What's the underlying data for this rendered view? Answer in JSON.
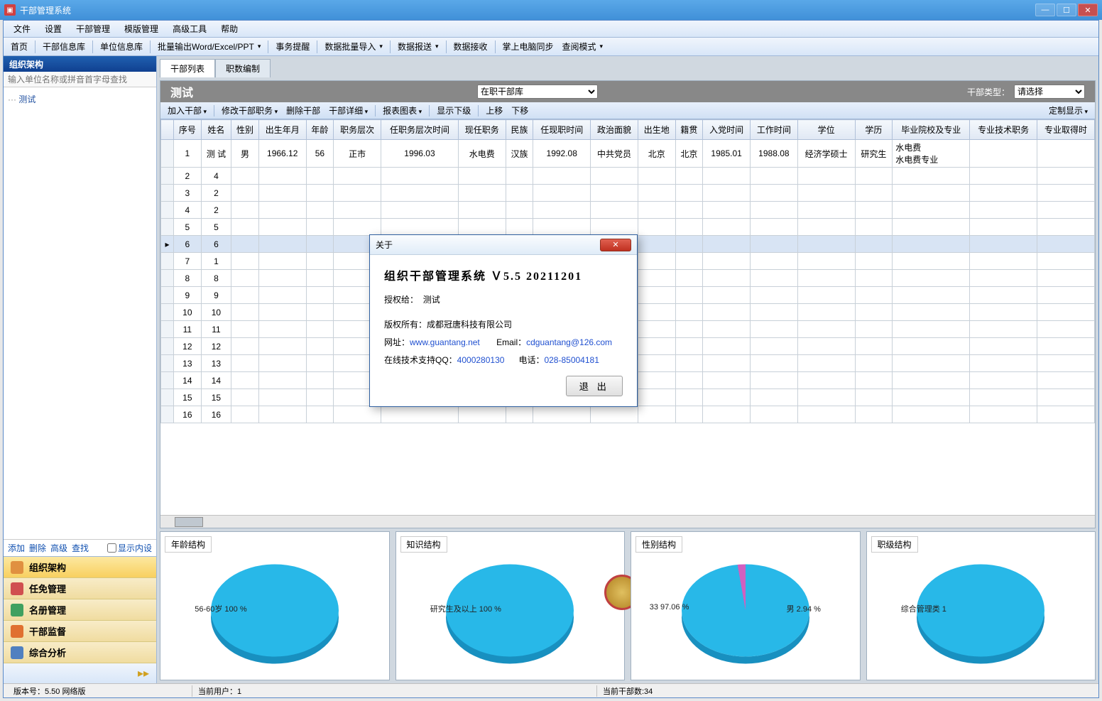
{
  "window": {
    "title": "干部管理系统"
  },
  "menu": [
    "文件",
    "设置",
    "干部管理",
    "模版管理",
    "高级工具",
    "帮助"
  ],
  "toolbar": [
    "首页",
    "干部信息库",
    "单位信息库",
    "批量输出Word/Excel/PPT",
    "事务提醒",
    "数据批量导入",
    "数据报送",
    "数据接收",
    "掌上电脑同步",
    "查阅模式"
  ],
  "toolbar_dd": [
    3,
    5,
    6,
    9
  ],
  "sidebar": {
    "header": "组织架构",
    "search_placeholder": "输入单位名称或拼音首字母查找",
    "tree_root": "测试",
    "actions": [
      "添加",
      "删除",
      "高级",
      "查找"
    ],
    "show_internal": "显示内设",
    "nav": [
      "组织架构",
      "任免管理",
      "名册管理",
      "干部监督",
      "综合分析"
    ]
  },
  "tabs": [
    "干部列表",
    "职数编制"
  ],
  "tabs_active": 0,
  "panel": {
    "title": "测试",
    "db_options": [
      "在职干部库"
    ],
    "type_label": "干部类型：",
    "type_options": [
      "请选择"
    ],
    "toolbar": [
      "加入干部",
      "修改干部职务",
      "删除干部",
      "干部详细",
      "报表图表",
      "显示下级",
      "上移",
      "下移"
    ],
    "toolbar_dd": [
      0,
      1,
      3,
      4
    ],
    "custom": "定制显示"
  },
  "columns": [
    "序号",
    "姓名",
    "性别",
    "出生年月",
    "年龄",
    "职务层次",
    "任职务层次时间",
    "现任职务",
    "民族",
    "任现职时间",
    "政治面貌",
    "出生地",
    "籍贯",
    "入党时间",
    "工作时间",
    "学位",
    "学历",
    "毕业院校及专业",
    "专业技术职务",
    "专业取得时"
  ],
  "rows": [
    {
      "n": 1,
      "c2": "测　试",
      "name": "测 试",
      "sex": "男",
      "dob": "1966.12",
      "age": "56",
      "lvl": "正市",
      "lvlt": "1996.03",
      "job": "水电费",
      "eth": "汉族",
      "jobt": "1992.08",
      "pol": "中共党员",
      "birth": "北京",
      "orig": "北京",
      "party": "1985.01",
      "work": "1988.08",
      "deg": "经济学硕士",
      "edu": "研究生",
      "school": "水电费\n水电费专业"
    },
    {
      "n": 2,
      "c2": "4"
    },
    {
      "n": 3,
      "c2": "2"
    },
    {
      "n": 4,
      "c2": "2"
    },
    {
      "n": 5,
      "c2": "5"
    },
    {
      "n": 6,
      "c2": "6",
      "sel": true
    },
    {
      "n": 7,
      "c2": "1"
    },
    {
      "n": 8,
      "c2": "8"
    },
    {
      "n": 9,
      "c2": "9"
    },
    {
      "n": 10,
      "c2": "10"
    },
    {
      "n": 11,
      "c2": "11"
    },
    {
      "n": 12,
      "c2": "12"
    },
    {
      "n": 13,
      "c2": "13"
    },
    {
      "n": 14,
      "c2": "14"
    },
    {
      "n": 15,
      "c2": "15"
    },
    {
      "n": 16,
      "c2": "16"
    }
  ],
  "charts": [
    {
      "title": "年龄结构",
      "label": "56-60岁 100 %"
    },
    {
      "title": "知识结构",
      "label": "研究生及以上 100 %"
    },
    {
      "title": "性别结构",
      "label": "33 97.06 %",
      "label2": "男 2.94 %",
      "sliced": true
    },
    {
      "title": "职级结构",
      "label": "综合管理类 1"
    }
  ],
  "chart_data": [
    {
      "type": "pie",
      "title": "年龄结构",
      "series": [
        {
          "name": "56-60岁",
          "value": 100,
          "unit": "%"
        }
      ]
    },
    {
      "type": "pie",
      "title": "知识结构",
      "series": [
        {
          "name": "研究生及以上",
          "value": 100,
          "unit": "%"
        }
      ]
    },
    {
      "type": "pie",
      "title": "性别结构",
      "series": [
        {
          "name": "33",
          "value": 97.06,
          "unit": "%"
        },
        {
          "name": "男",
          "value": 2.94,
          "unit": "%"
        }
      ]
    },
    {
      "type": "pie",
      "title": "职级结构",
      "series": [
        {
          "name": "综合管理类",
          "value": 1
        }
      ]
    }
  ],
  "status": {
    "version": "版本号：5.50 网络版",
    "users": "当前用户：1",
    "count": "当前干部数:34"
  },
  "dialog": {
    "title": "关于",
    "heading": "组织干部管理系统 Ｖ5.5 20211201",
    "auth_label": "授权给：",
    "auth_val": "测试",
    "copyright": "版权所有：成都冠唐科技有限公司",
    "url_label": "网址：",
    "url": "www.guantang.net",
    "email_label": "Email：",
    "email": "cdguantang@126.com",
    "qq_label": "在线技术支持QQ：",
    "qq": "4000280130",
    "tel_label": "电话：",
    "tel": "028-85004181",
    "exit": "退 出"
  }
}
